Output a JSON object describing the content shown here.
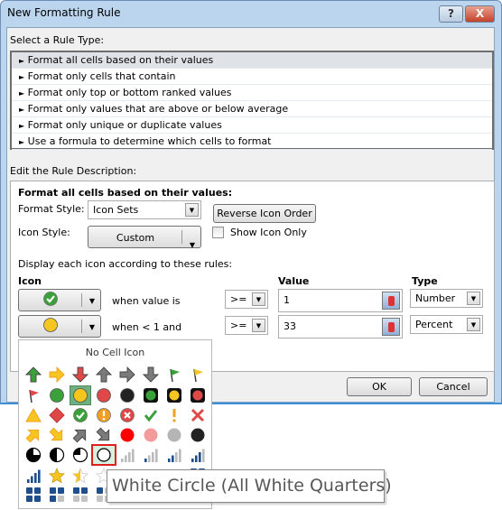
{
  "window": {
    "title": "New Formatting Rule",
    "help_label": "?",
    "close_label": "X"
  },
  "rule_type": {
    "label": "Select a Rule Type:",
    "items": [
      "Format all cells based on their values",
      "Format only cells that contain",
      "Format only top or bottom ranked values",
      "Format only values that are above or below average",
      "Format only unique or duplicate values",
      "Use a formula to determine which cells to format"
    ],
    "selected": 0,
    "bullet": "►"
  },
  "description": {
    "label": "Edit the Rule Description:",
    "heading": "Format all cells based on their values:",
    "format_style_label": "Format Style:",
    "format_style_value": "Icon Sets",
    "reverse_label": "Reverse Icon Order",
    "icon_style_label": "Icon Style:",
    "icon_style_value": "Custom",
    "show_icon_only_label": "Show Icon Only",
    "show_icon_only_checked": false,
    "display_label": "Display each icon according to these rules:",
    "col_icon": "Icon",
    "col_value": "Value",
    "col_type": "Type",
    "rules": [
      {
        "icon": "check-circle-green",
        "condition": "when value is",
        "operator": ">=",
        "value": "1",
        "type": "Number"
      },
      {
        "icon": "circle-yellow",
        "condition": "when < 1 and",
        "operator": ">=",
        "value": "33",
        "type": "Percent"
      }
    ]
  },
  "buttons": {
    "ok": "OK",
    "cancel": "Cancel"
  },
  "icon_picker": {
    "no_icon_label": "No Cell Icon",
    "selected": "circle-yellow",
    "hovered": "circle-white",
    "rows": [
      [
        "arrow-up-green",
        "arrow-right-yellow",
        "arrow-down-red",
        "arrow-up-gray",
        "arrow-right-gray",
        "arrow-down-gray",
        "flag-green",
        "flag-yellow"
      ],
      [
        "flag-red",
        "circle-green",
        "circle-yellow",
        "circle-red",
        "circle-black",
        "light-green",
        "light-yellow",
        "light-red"
      ],
      [
        "triangle-yellow",
        "diamond-red",
        "check-circle-green",
        "exclaim-circle-yellow",
        "x-circle-red",
        "check-green",
        "exclaim-yellow",
        "x-red"
      ],
      [
        "arrow-upright-yellow",
        "arrow-downright-yellow",
        "arrow-upright-gray",
        "arrow-downright-gray",
        "dot-red",
        "dot-pink",
        "dot-gray",
        "dot-black"
      ],
      [
        "pie-3",
        "pie-2",
        "pie-1",
        "circle-white",
        "bars-0",
        "bars-1",
        "bars-2",
        "bars-3"
      ],
      [
        "bars-4",
        "star-full",
        "star-half",
        "star-empty",
        "",
        "",
        "",
        "boxes-4"
      ],
      [
        "boxes-4",
        "boxes-3",
        "boxes-2",
        "boxes-1",
        "",
        "",
        "",
        ""
      ]
    ],
    "tooltip": "White Circle (All White Quarters)"
  },
  "colors": {
    "green": "#3a9a3a",
    "yellow": "#f5c518",
    "red": "#e04040",
    "gray": "#7a7a7a",
    "selection": "#6fae7f",
    "hover_border": "#e02020"
  }
}
